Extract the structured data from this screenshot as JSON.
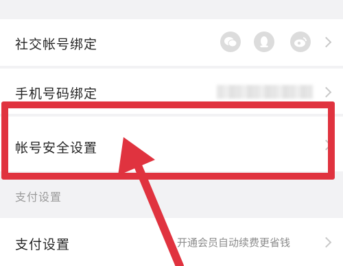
{
  "rows": {
    "social_binding": {
      "label": "社交帐号绑定"
    },
    "phone_binding": {
      "label": "手机号码绑定"
    },
    "account_security": {
      "label": "帐号安全设置"
    },
    "payment_settings": {
      "label": "支付设置",
      "hint": "开通会员自动续费更省钱"
    }
  },
  "section_header": "支付设置",
  "social_icons": [
    "wechat-icon",
    "qq-icon",
    "weibo-icon"
  ],
  "colors": {
    "highlight": "#e0333f",
    "background": "#f2f2f4",
    "icon_gray": "#dcdcdc"
  }
}
